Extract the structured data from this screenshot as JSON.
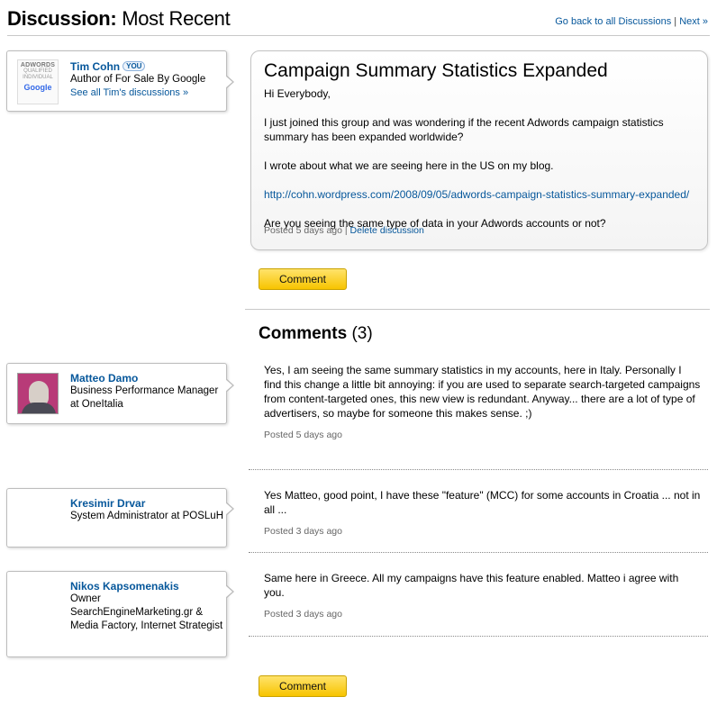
{
  "header": {
    "title_bold": "Discussion:",
    "title_rest": " Most Recent",
    "back_link": "Go back to all Discussions",
    "separator": " | ",
    "next_link": "Next »"
  },
  "author": {
    "badge_line1": "ADWORDS",
    "badge_line2": "QUALIFIED",
    "badge_line3": "INDIVIDUAL",
    "badge_logo": "Google",
    "name": "Tim Cohn",
    "you_badge": "YOU",
    "title": "Author of For Sale By Google",
    "see_all": "See all Tim's discussions »"
  },
  "post": {
    "title": "Campaign Summary Statistics Expanded",
    "greeting": "Hi Everybody,",
    "para1": "I just joined this group and was wondering if the recent Adwords campaign statistics summary has been expanded worldwide?",
    "para2": "I wrote about what we are seeing here in the US on my blog.",
    "link": "http://cohn.wordpress.com/2008/09/05/adwords-campaign-statistics-summary-expanded/",
    "para3": "Are you seeing the same type of data in your Adwords accounts or not?",
    "posted": "Posted 5 days ago",
    "meta_sep": " | ",
    "delete": "Delete discussion"
  },
  "buttons": {
    "comment": "Comment"
  },
  "comments_header": {
    "label": "Comments",
    "count": " (3)"
  },
  "comments": [
    {
      "name": "Matteo Damo",
      "role": "Business Performance Manager at OneItalia",
      "text": "Yes, I am seeing the same summary statistics in my accounts, here in Italy. Personally I find this change a little bit annoying: if you are used to separate search-targeted campaigns from content-targeted ones, this new view is redundant. Anyway... there are a lot of type of advertisers, so maybe for someone this makes sense. ;)",
      "posted": "Posted 5 days ago"
    },
    {
      "name": "Kresimir Drvar",
      "role": "System Administrator at POSLuH",
      "text": "Yes Matteo, good point, I have these \"feature\" (MCC) for some accounts in Croatia ... not in all ...",
      "posted": "Posted 3 days ago"
    },
    {
      "name": "Nikos Kapsomenakis",
      "role": "Owner SearchEngineMarketing.gr & Media Factory, Internet Strategist",
      "text": "Same here in Greece. All my campaigns have this feature enabled. Matteo i agree with you.",
      "posted": "Posted 3 days ago"
    }
  ]
}
